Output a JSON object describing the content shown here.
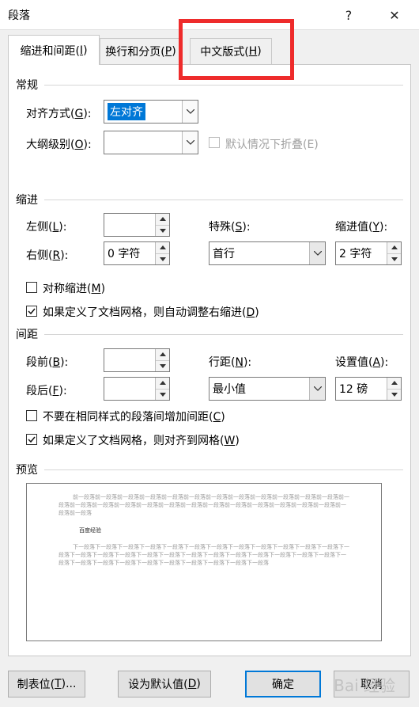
{
  "window": {
    "title": "段落",
    "help_glyph": "?",
    "close_glyph": "✕"
  },
  "tabs": [
    {
      "label": "缩进和间距(I)",
      "key": "I",
      "pre": "缩进和间距(",
      "post": ")"
    },
    {
      "label": "换行和分页(P)",
      "pre": "换行和分页(",
      "key": "P",
      "post": ")"
    },
    {
      "label": "中文版式(H)",
      "pre": "中文版式(",
      "key": "H",
      "post": ")"
    }
  ],
  "general": {
    "heading": "常规",
    "alignment_label_pre": "对齐方式(",
    "alignment_label_key": "G",
    "alignment_label_post": "):",
    "alignment_value": "左对齐",
    "outline_label_pre": "大纲级别(",
    "outline_label_key": "O",
    "outline_label_post": "):",
    "outline_value": "",
    "collapse_label": "默认情况下折叠(E)"
  },
  "indent": {
    "heading": "缩进",
    "left_label_pre": "左侧(",
    "left_label_key": "L",
    "left_label_post": "):",
    "left_value": "",
    "right_label_pre": "右侧(",
    "right_label_key": "R",
    "right_label_post": "):",
    "right_value": "0 字符",
    "special_label_pre": "特殊(",
    "special_label_key": "S",
    "special_label_post": "):",
    "special_value": "首行",
    "by_label_pre": "缩进值(",
    "by_label_key": "Y",
    "by_label_post": "):",
    "by_value": "2 字符",
    "mirror_label_pre": "对称缩进(",
    "mirror_label_key": "M",
    "mirror_label_post": ")",
    "mirror_checked": false,
    "auto_adjust_label_pre": "如果定义了文档网格，则自动调整右缩进(",
    "auto_adjust_label_key": "D",
    "auto_adjust_label_post": ")",
    "auto_adjust_checked": true
  },
  "spacing": {
    "heading": "间距",
    "before_label_pre": "段前(",
    "before_label_key": "B",
    "before_label_post": "):",
    "before_value": "",
    "after_label_pre": "段后(",
    "after_label_key": "F",
    "after_label_post": "):",
    "after_value": "",
    "line_spacing_label_pre": "行距(",
    "line_spacing_label_key": "N",
    "line_spacing_label_post": "):",
    "line_spacing_value": "最小值",
    "at_label_pre": "设置值(",
    "at_label_key": "A",
    "at_label_post": "):",
    "at_value": "12 磅",
    "no_space_label_pre": "不要在相同样式的段落间增加间距(",
    "no_space_label_key": "C",
    "no_space_label_post": ")",
    "no_space_checked": false,
    "snap_grid_label_pre": "如果定义了文档网格，则对齐到网格(",
    "snap_grid_label_key": "W",
    "snap_grid_label_post": ")",
    "snap_grid_checked": true
  },
  "preview": {
    "heading": "预览",
    "prev_paragraph": "前一段落前一段落前一段落前一段落前一段落前一段落前一段落前一段落前一段落前一段落前一段落前一段落前一段落前一段落前一段落前一段落前一段落前一段落前一段落前一段落前一段落前一段落前一段落前一段落前一段落前一段落前一段落",
    "current_paragraph": "百度经验",
    "next_paragraph": "下一段落下一段落下一段落下一段落下一段落下一段落下一段落下一段落下一段落下一段落下一段落下一段落下一段落下一段落下一段落下一段落下一段落下一段落下一段落下一段落下一段落下一段落下一段落下一段落下一段落下一段落下一段落下一段落下一段落下一段落下一段落下一段落下一段落下一段落下一段落"
  },
  "buttons": {
    "tabs_pre": "制表位(",
    "tabs_key": "T",
    "tabs_post": ")...",
    "default_pre": "设为默认值(",
    "default_key": "D",
    "default_post": ")",
    "ok": "确定",
    "cancel": "取消"
  },
  "watermark": "Bai 经验",
  "colors": {
    "accent": "#0078d7",
    "highlight": "#ee2b2b"
  }
}
